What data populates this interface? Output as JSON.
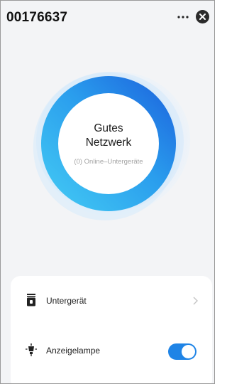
{
  "header": {
    "title": "00176637",
    "more_icon": "more-dots-icon",
    "close_icon": "close-icon"
  },
  "network": {
    "status": "Gutes Netzwerk",
    "subdevices": "(0) Online–Untergeräte",
    "ring_gradient": [
      "#1c6ee0",
      "#3fc6f2"
    ]
  },
  "settings": {
    "subdevice_label": "Untergerät",
    "subdevice_icon": "subdevice-icon",
    "lamp_label": "Anzeigelampe",
    "lamp_icon": "lamp-icon",
    "lamp_enabled": true
  },
  "colors": {
    "accent": "#1f84e6"
  }
}
